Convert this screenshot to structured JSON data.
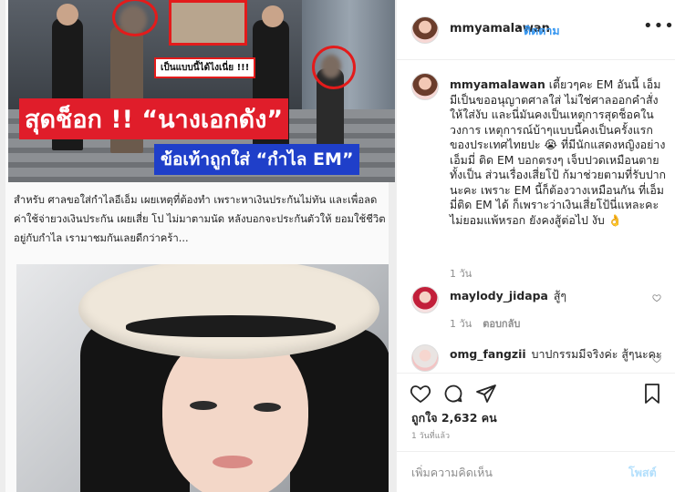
{
  "post": {
    "image_overlay": {
      "small_caption": "เป็นแบบนี้ได้ไงเนี่ย !!!",
      "headline_red": "สุดช็อก !! “นางเอกดัง”",
      "headline_blue": "ข้อเท้าถูกใส่ “กำไล EM”"
    },
    "article_text": "สำหรับ ศาลขอใส่กำไลอีเอ็ม เผยเหตุที่ต้องทำ เพราะหาเงินประกันไม่ทัน และเพื่อลดค่าใช้จ่ายวงเงินประกัน เผยเสี่ย โป ไม่มาตามนัด หลังบอกจะประกันตัวให้ ยอมใช้ชีวิตอยู่กับกำไล เรามาชมกันเลยดีกว่าคร้า..."
  },
  "header": {
    "username": "mmyamalawan",
    "separator": "•",
    "follow_label": "ติดตาม",
    "more_icon": "more-horizontal-icon"
  },
  "caption": {
    "username": "mmyamalawan",
    "text": "เตี้ยวๆคะ EM อันนี้ เอ็มมีเป็นขออนุญาตศาลใส่ ไม่ใช่ศาลออกคำสั่งให้ใส่งับ และนี่มันคงเป็นเหตุการสุดช็อคในวงการ เหตุการณ์บ้าๆแบบนี้คงเป็นครั้งแรกของประเทศไทยปะ 😭 ที่มีนักแสดงหญิงอย่างเอ็มมี่ ติด EM บอกตรงๆ เจ็บปวดเหมือนตายทั้งเป็น ส่วนเรื่องเสี่ยโป้ ก้มาช่วยตามที่รับปากนะคะ เพราะ EM นี้ก็ต้องวางเหมือนกัน ที่เอ็มมี่ติด EM ได้ ก็เพราะว่าเงินเสี่ยโป้นี่แหละคะ ไม่ยอมแพ้หรอก ยังคงสู้ต่อไป งับ 👌",
    "time": "1 วัน"
  },
  "comments": [
    {
      "username": "maylody_jidapa",
      "text": "สู้ๆ",
      "time": "1 วัน",
      "reply_label": "ตอบกลับ"
    },
    {
      "username": "omg_fangzii",
      "text": "บาปกรรมมีจริงค่ะ สู้ๆนะคะ",
      "time": "",
      "reply_label": ""
    }
  ],
  "actions": {
    "like_icon": "heart-icon",
    "comment_icon": "comment-icon",
    "share_icon": "share-icon",
    "save_icon": "bookmark-icon",
    "likes_text": "ถูกใจ 2,632 คน",
    "time_ago": "1 วันที่แล้ว"
  },
  "comment_box": {
    "placeholder": "เพิ่มความคิดเห็น",
    "post_label": "โพสต์"
  },
  "colors": {
    "accent_blue": "#3897f0",
    "post_disabled": "#b2dffc",
    "headline_red": "#e01d2a",
    "headline_blue": "#1f3fc9"
  }
}
